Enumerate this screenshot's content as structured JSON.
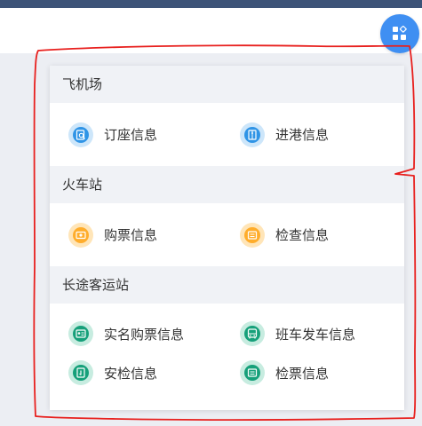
{
  "sections": [
    {
      "title": "飞机场",
      "items": [
        {
          "label": "订座信息",
          "icon": "booking-search-icon",
          "color": "#2f94e6"
        },
        {
          "label": "进港信息",
          "icon": "arrival-door-icon",
          "color": "#2f94e6"
        }
      ]
    },
    {
      "title": "火车站",
      "items": [
        {
          "label": "购票信息",
          "icon": "ticket-icon",
          "color": "#ffad2b"
        },
        {
          "label": "检查信息",
          "icon": "check-card-icon",
          "color": "#ffad2b"
        }
      ]
    },
    {
      "title": "长途客运站",
      "items": [
        {
          "label": "实名购票信息",
          "icon": "id-ticket-icon",
          "color": "#16a07a"
        },
        {
          "label": "班车发车信息",
          "icon": "bus-icon",
          "color": "#16a07a"
        },
        {
          "label": "安检信息",
          "icon": "security-check-icon",
          "color": "#16a07a"
        },
        {
          "label": "检票信息",
          "icon": "ticket-check-icon",
          "color": "#16a07a"
        }
      ]
    }
  ],
  "header": {
    "apps_button_icon": "apps-grid-icon",
    "accent": "#3f8ff2"
  },
  "colors": {
    "top_bar": "#3d5378",
    "annotation": "#e8201e",
    "panel_bg": "#ffffff",
    "section_bg": "#f0f2f6"
  }
}
